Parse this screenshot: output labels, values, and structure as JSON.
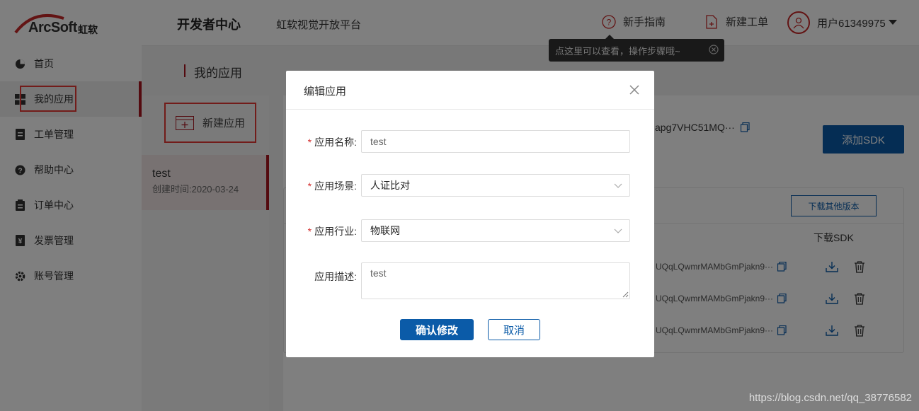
{
  "brand": {
    "logo_text": "ArcSoft",
    "logo_cn": "虹软"
  },
  "sidebar": {
    "items": [
      {
        "label": "首页",
        "icon": "dashboard-icon"
      },
      {
        "label": "我的应用",
        "icon": "grid-icon",
        "active": true
      },
      {
        "label": "工单管理",
        "icon": "ticket-icon"
      },
      {
        "label": "帮助中心",
        "icon": "help-icon"
      },
      {
        "label": "订单中心",
        "icon": "clipboard-icon"
      },
      {
        "label": "发票管理",
        "icon": "invoice-icon"
      },
      {
        "label": "账号管理",
        "icon": "gear-icon"
      }
    ]
  },
  "header": {
    "title": "开发者中心",
    "subtitle": "虹软视觉开放平台",
    "guide_label": "新手指南",
    "new_ticket_label": "新建工单",
    "user_label": "用户61349975",
    "tooltip": "点这里可以查看，操作步骤哦~"
  },
  "main": {
    "page_title": "我的应用",
    "new_app_label": "新建应用",
    "app": {
      "name": "test",
      "created": "创建时间:2020-03-24"
    },
    "app_key": "apg7VHC51MQ···",
    "add_sdk_label": "添加SDK",
    "download_other_label": "下载其他版本",
    "sdk_column_header": "下载SDK",
    "sdk_rows": [
      {
        "key": "UQqLQwmrMAMbGmPjakn9···"
      },
      {
        "key": "UQqLQwmrMAMbGmPjakn9···"
      },
      {
        "key": "UQqLQwmrMAMbGmPjakn9···"
      }
    ]
  },
  "modal": {
    "title": "编辑应用",
    "fields": {
      "name": {
        "label": "应用名称:",
        "value": "test",
        "required": true
      },
      "scene": {
        "label": "应用场景:",
        "value": "人证比对",
        "required": true
      },
      "industry": {
        "label": "应用行业:",
        "value": "物联网",
        "required": true
      },
      "desc": {
        "label": "应用描述:",
        "value": "test",
        "required": false
      }
    },
    "required_mark": "*",
    "confirm_label": "确认修改",
    "cancel_label": "取消"
  },
  "watermark": "https://blog.csdn.net/qq_38776582",
  "colors": {
    "brand_red": "#a8141e",
    "primary_blue": "#0b5ba8",
    "highlight_red": "#e53935"
  }
}
